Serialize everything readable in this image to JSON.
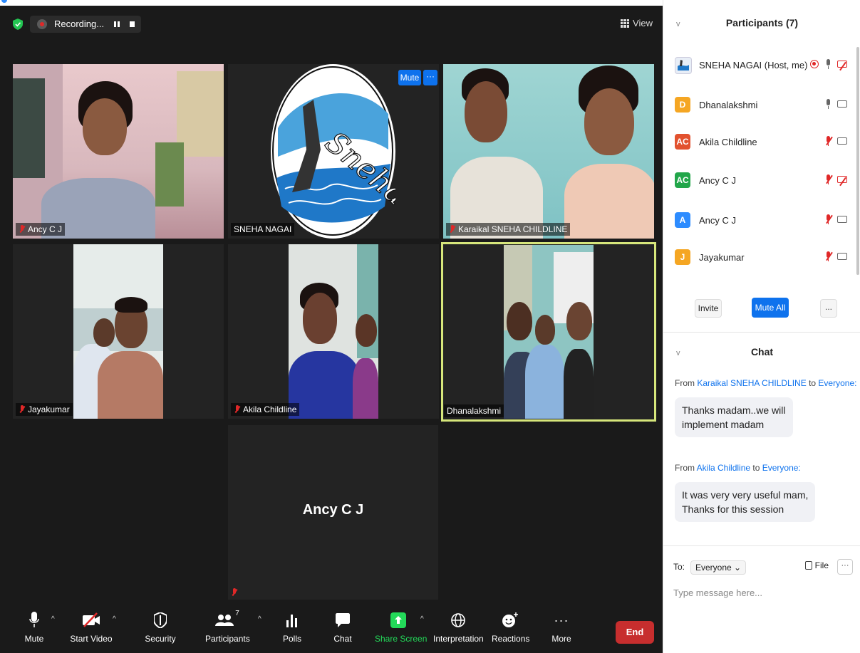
{
  "meeting": {
    "recording_label": "Recording...",
    "view_label": "View"
  },
  "tiles": [
    {
      "name": "Ancy C J",
      "muted": true
    },
    {
      "name": "SNEHA NAGAI",
      "muted": false
    },
    {
      "name": "Karaikal SNEHA CHILDLINE",
      "muted": true
    },
    {
      "name": "Jayakumar",
      "muted": true
    },
    {
      "name": "Akila Childline",
      "muted": true
    },
    {
      "name": "Dhanalakshmi",
      "muted": false,
      "active_speaker": true
    }
  ],
  "logo_text": "Sneha",
  "tile_controls": {
    "mute": "Mute",
    "more": "···"
  },
  "video_off_tile": {
    "name": "Ancy C J"
  },
  "toolbar": {
    "items": [
      {
        "label": "Mute"
      },
      {
        "label": "Start Video"
      },
      {
        "label": "Security"
      },
      {
        "label": "Participants",
        "count": "7"
      },
      {
        "label": "Polls"
      },
      {
        "label": "Chat"
      },
      {
        "label": "Share Screen"
      },
      {
        "label": "Interpretation"
      },
      {
        "label": "Reactions"
      },
      {
        "label": "More"
      }
    ],
    "end_label": "End",
    "colors": {
      "share_screen": "#23d959",
      "end": "#c72e2e"
    }
  },
  "participants_panel": {
    "header": "Participants (7)",
    "list": [
      {
        "name": "SNEHA NAGAI (Host, me)",
        "avatar_initials": "",
        "avatar_color": "#ffffff",
        "mic": "on",
        "video": "off",
        "recording": true
      },
      {
        "name": "Dhanalakshmi",
        "avatar_initials": "D",
        "avatar_color": "#f5a623",
        "mic": "on",
        "video": "on"
      },
      {
        "name": "Akila Childline",
        "avatar_initials": "AC",
        "avatar_color": "#e2522f",
        "mic": "off",
        "video": "on"
      },
      {
        "name": "Ancy C J",
        "avatar_initials": "AC",
        "avatar_color": "#22a64a",
        "mic": "off",
        "video": "off"
      },
      {
        "name": "Ancy C J",
        "avatar_initials": "A",
        "avatar_color": "#2d8cff",
        "mic": "off",
        "video": "on"
      },
      {
        "name": "Jayakumar",
        "avatar_initials": "J",
        "avatar_color": "#f5a623",
        "mic": "off",
        "video": "on"
      }
    ],
    "buttons": {
      "invite": "Invite",
      "mute_all": "Mute All",
      "more": "..."
    }
  },
  "chat": {
    "header": "Chat",
    "messages": [
      {
        "from_prefix": "From ",
        "sender": "Karaikal SNEHA CHILDLINE",
        "to_word": " to ",
        "recipient": "Everyone:",
        "text_line1": "Thanks madam..we will",
        "text_line2": "implement madam"
      },
      {
        "from_prefix": "From ",
        "sender": "Akila Childline",
        "to_word": " to ",
        "recipient": "Everyone:",
        "text_line1": "It was very very useful mam,",
        "text_line2": "Thanks for this session"
      }
    ],
    "to_label": "To:",
    "recipient_select": "Everyone",
    "file_label": "File",
    "more_label": "···",
    "input_placeholder": "Type message here..."
  }
}
